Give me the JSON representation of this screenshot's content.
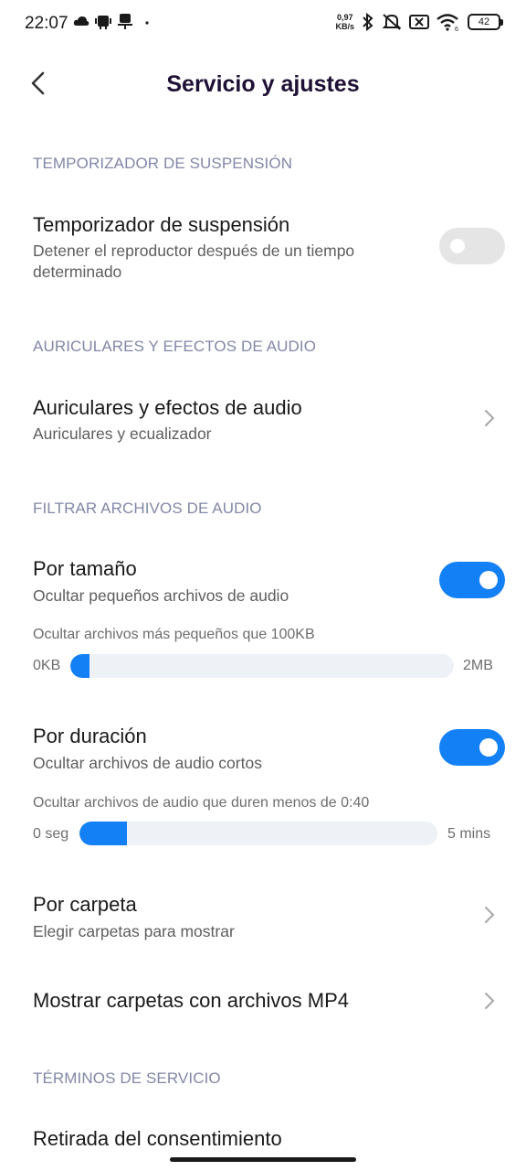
{
  "status_bar": {
    "time": "22:07",
    "net_speed_value": "0,97",
    "net_speed_unit": "KB/s",
    "battery": "42",
    "icons": [
      "cloud-icon",
      "android-icon",
      "notification-icon",
      "dot-icon",
      "bluetooth-icon",
      "mute-icon",
      "sim-off-icon",
      "wifi-icon",
      "battery-icon"
    ]
  },
  "header": {
    "title": "Servicio y ajustes"
  },
  "sections": {
    "sleep_timer_header": "TEMPORIZADOR DE SUSPENSIÓN",
    "audio_effects_header": "AURICULARES Y EFECTOS DE AUDIO",
    "filter_header": "FILTRAR ARCHIVOS DE AUDIO",
    "terms_header": "TÉRMINOS DE SERVICIO"
  },
  "sleep_timer": {
    "title": "Temporizador de suspensión",
    "subtitle": "Detener el reproductor después de un tiempo determinado",
    "enabled": false
  },
  "audio_effects": {
    "title": "Auriculares y efectos de audio",
    "subtitle": "Auriculares y ecualizador"
  },
  "by_size": {
    "title": "Por tamaño",
    "subtitle": "Ocultar pequeños archivos de audio",
    "enabled": true,
    "caption": "Ocultar archivos más pequeños que 100KB",
    "min_label": "0KB",
    "max_label": "2MB",
    "value_fraction": 0.05
  },
  "by_duration": {
    "title": "Por duración",
    "subtitle": "Ocultar archivos de audio cortos",
    "enabled": true,
    "caption": "Ocultar archivos de audio que duren menos de 0:40",
    "min_label": "0 seg",
    "max_label": "5 mins",
    "value_fraction": 0.133
  },
  "by_folder": {
    "title": "Por carpeta",
    "subtitle": "Elegir carpetas para mostrar"
  },
  "mp4_folders": {
    "title": "Mostrar carpetas con archivos MP4"
  },
  "consent": {
    "title": "Retirada del consentimiento"
  },
  "colors": {
    "accent": "#1380f5",
    "section_header": "#8287a6",
    "title": "#1f1035"
  }
}
